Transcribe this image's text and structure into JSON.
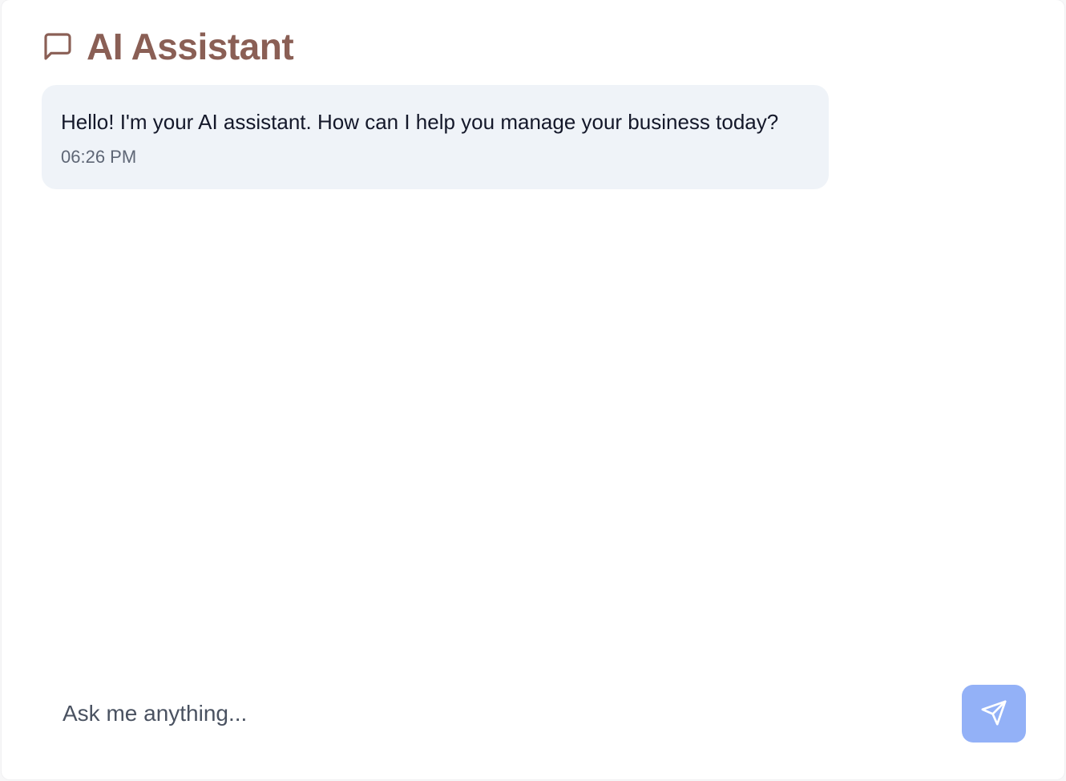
{
  "header": {
    "title": "AI Assistant",
    "icon": "message-square-icon",
    "title_color": "#8a5f55"
  },
  "messages": [
    {
      "role": "assistant",
      "text": "Hello! I'm your AI assistant. How can I help you manage your business today?",
      "time": "06:26 PM"
    }
  ],
  "composer": {
    "placeholder": "Ask me anything...",
    "value": "",
    "send_icon": "send-icon",
    "send_color": "#93b1f7"
  }
}
